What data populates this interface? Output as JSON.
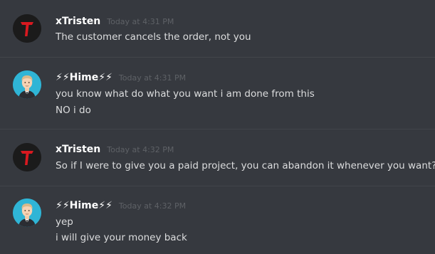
{
  "messages": [
    {
      "author": "xTristen",
      "avatar": "tristen-logo-avatar",
      "timestamp": "Today at 4:31 PM",
      "lines": [
        "The customer cancels the order, not you"
      ]
    },
    {
      "author": "⚡⚡Hime⚡⚡",
      "avatar": "cartoon-man-avatar",
      "timestamp": "Today at 4:31 PM",
      "lines": [
        "you know what do what you want i am done from this",
        "NO i do"
      ]
    },
    {
      "author": "xTristen",
      "avatar": "tristen-logo-avatar",
      "timestamp": "Today at 4:32 PM",
      "lines": [
        "So if I were to give you a paid project, you can abandon it whenever you want?"
      ]
    },
    {
      "author": "⚡⚡Hime⚡⚡",
      "avatar": "cartoon-man-avatar",
      "timestamp": "Today at 4:32 PM",
      "lines": [
        "yep",
        "i will give your money back"
      ]
    }
  ],
  "colors": {
    "background": "#36393f",
    "divider": "#42454a",
    "username": "#ffffff",
    "timestamp": "#5e6166",
    "message_text": "#dcddde",
    "tristen_avatar_bg": "#1b1b1b",
    "tristen_logo": "#d81920",
    "hime_avatar_bg": "#2fb5d6"
  }
}
